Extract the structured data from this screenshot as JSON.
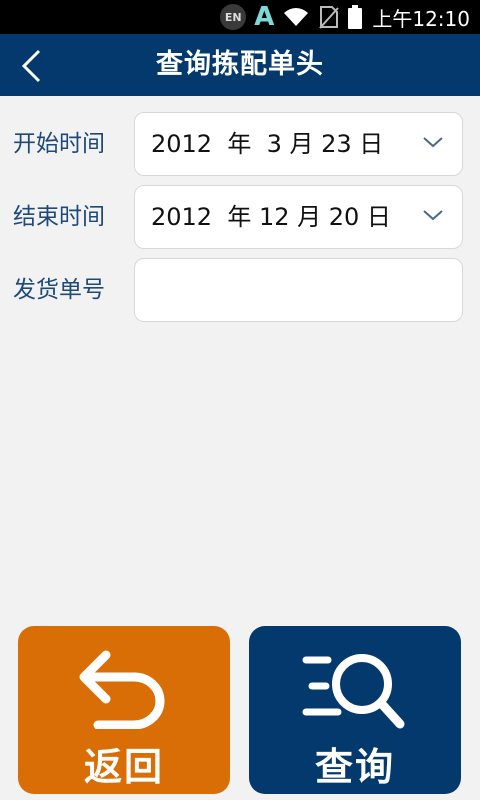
{
  "status_bar": {
    "input_badge": "EN",
    "app_glyph": "A",
    "time": "上午12:10",
    "icons": [
      "keyboard-en-icon",
      "a-notification-icon",
      "wifi-icon",
      "no-sim-icon",
      "battery-icon"
    ]
  },
  "header": {
    "title": "查询拣配单头",
    "back_icon": "chevron-left-icon"
  },
  "form": {
    "start_label": "开始时间",
    "start_value": "2012  年  3 月 23 日",
    "end_label": "结束时间",
    "end_value": "2012  年 12 月 20 日",
    "order_label": "发货单号",
    "order_value": ""
  },
  "buttons": {
    "back_label": "返回",
    "query_label": "查询"
  },
  "colors": {
    "primary": "#03396c",
    "accent": "#da6e06",
    "background": "#f2f2f2",
    "label": "#1f4a78"
  }
}
